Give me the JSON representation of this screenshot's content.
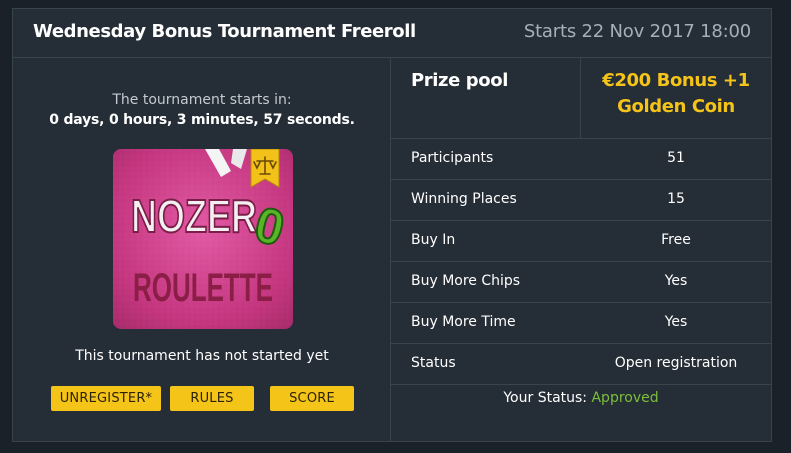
{
  "header": {
    "title": "Wednesday Bonus Tournament Freeroll",
    "start_label": "Starts 22 Nov 2017 18:00"
  },
  "left": {
    "countdown_label": "The tournament starts in:",
    "countdown_value": "0 days, 0 hours, 3 minutes, 57 seconds.",
    "game_logo": {
      "line1": "NOZER",
      "accent": "0",
      "line2": "ROULETTE"
    },
    "status_text": "This tournament has not started yet",
    "buttons": {
      "unregister": "UNREGISTER*",
      "rules": "RULES",
      "score": "SCORE"
    }
  },
  "prize": {
    "label": "Prize pool",
    "value_line1": "€200 Bonus +1",
    "value_line2": "Golden Coin"
  },
  "details": [
    {
      "label": "Participants",
      "value": "51"
    },
    {
      "label": "Winning Places",
      "value": "15"
    },
    {
      "label": "Buy In",
      "value": "Free"
    },
    {
      "label": "Buy More Chips",
      "value": "Yes"
    },
    {
      "label": "Buy More Time",
      "value": "Yes"
    },
    {
      "label": "Status",
      "value": "Open registration"
    }
  ],
  "your_status": {
    "label": "Your Status:",
    "value": "Approved"
  },
  "colors": {
    "background": "#1b2128",
    "panel": "#252d36",
    "accent_yellow": "#f5c418",
    "approved_green": "#7cbf3a",
    "game_pink": "#c4367f"
  }
}
